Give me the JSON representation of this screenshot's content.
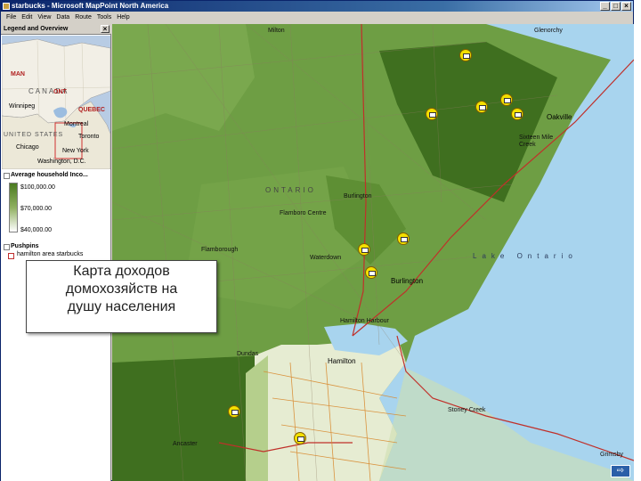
{
  "window": {
    "title": "starbucks - Microsoft MapPoint North America",
    "minimize": "_",
    "maximize": "□",
    "close": "×"
  },
  "menu": [
    "File",
    "Edit",
    "View",
    "Data",
    "Route",
    "Tools",
    "Help"
  ],
  "legend": {
    "header": "Legend and Overview",
    "close": "×",
    "overview_labels": {
      "canada": "CANADA",
      "winnipeg": "Winnipeg",
      "quebec": "QUEBEC",
      "montreal": "Montreal",
      "toronto": "Toronto",
      "united_states": "UNITED STATES",
      "chicago": "Chicago",
      "new_york": "New York",
      "washington": "Washington, D.C.",
      "man": "MAN",
      "ont": "ONT"
    },
    "income": {
      "title": "Average household Inco...",
      "high": "$100,000.00",
      "mid": "$70,000.00",
      "low": "$40,000.00"
    },
    "pushpins": {
      "title": "Pushpins",
      "item": "hamilton area starbucks"
    }
  },
  "map": {
    "labels": {
      "ontario": "ONTARIO",
      "lake_ontario": "Lake Ontario",
      "oakville": "Oakville",
      "burlington": "Burlington",
      "burlington_north": "Burlington",
      "hamilton": "Hamilton",
      "flamborough": "Flamborough",
      "waterdown": "Waterdown",
      "flamboro_centre": "Flamboro Centre",
      "dundas": "Dundas",
      "ancaster": "Ancaster",
      "stoney_creek": "Stoney Creek",
      "grimsby": "Grimsby",
      "glenorchy": "Glenorchy",
      "milton": "Milton",
      "hamilton_harbour": "Hamilton Harbour",
      "sixteen_mile_creek": "Sixteen Mile Creek"
    }
  },
  "annotation": {
    "line1": "Карта доходов",
    "line2": "домохозяйств на",
    "line3": "душу населения"
  },
  "colors": {
    "income_high": "#3f6f1f",
    "income_mid": "#6a9b40",
    "income_low": "#e6ecd2",
    "lake": "#a8d4ee",
    "pin": "#f4e000"
  }
}
